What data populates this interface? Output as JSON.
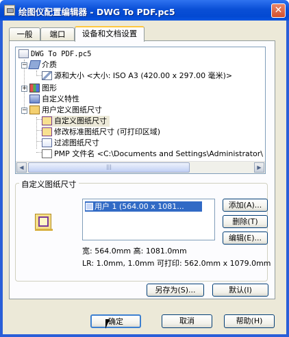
{
  "window": {
    "title": "绘图仪配置编辑器 - DWG To PDF.pc5",
    "close_label": "✕"
  },
  "tabs": [
    {
      "label": "一般"
    },
    {
      "label": "端口"
    },
    {
      "label": "设备和文档设置",
      "active": true
    }
  ],
  "tree": {
    "items": [
      {
        "label": "DWG To PDF.pc5"
      },
      {
        "label": "介质"
      },
      {
        "label": "源和大小 <大小: ISO A3 (420.00 x 297.00 毫米)>"
      },
      {
        "label": "图形"
      },
      {
        "label": "自定义特性"
      },
      {
        "label": "用户定义图纸尺寸"
      },
      {
        "label": "自定义图纸尺寸",
        "selected": true
      },
      {
        "label": "修改标准图纸尺寸 (可打印区域)"
      },
      {
        "label": "过滤图纸尺寸"
      },
      {
        "label": "PMP 文件名 <C:\\Documents and Settings\\Administrator\\"
      }
    ],
    "scroll_left": "◀",
    "scroll_right": "▶",
    "thumb_grip": "|||"
  },
  "custom_group": {
    "label": "自定义图纸尺寸",
    "list_items": [
      "用户 1 (564.00 x 1081..."
    ],
    "buttons": {
      "add": "添加(A)...",
      "delete": "删除(T)",
      "edit": "编辑(E)..."
    },
    "info_line1": "宽: 564.0mm 高: 1081.0mm",
    "info_line2": "LR: 1.0mm, 1.0mm  可打印: 562.0mm x 1079.0mm"
  },
  "panel_buttons": {
    "save_as": "另存为(S)...",
    "defaults": "默认(I)"
  },
  "dialog_buttons": {
    "ok": "确定",
    "cancel": "取消",
    "help": "帮助(H)"
  },
  "colors": {
    "title_blue": "#0a4fd6",
    "dialog_bg": "#ece9d8",
    "selection": "#316ac5",
    "accent_tab": "#ffc83c"
  }
}
